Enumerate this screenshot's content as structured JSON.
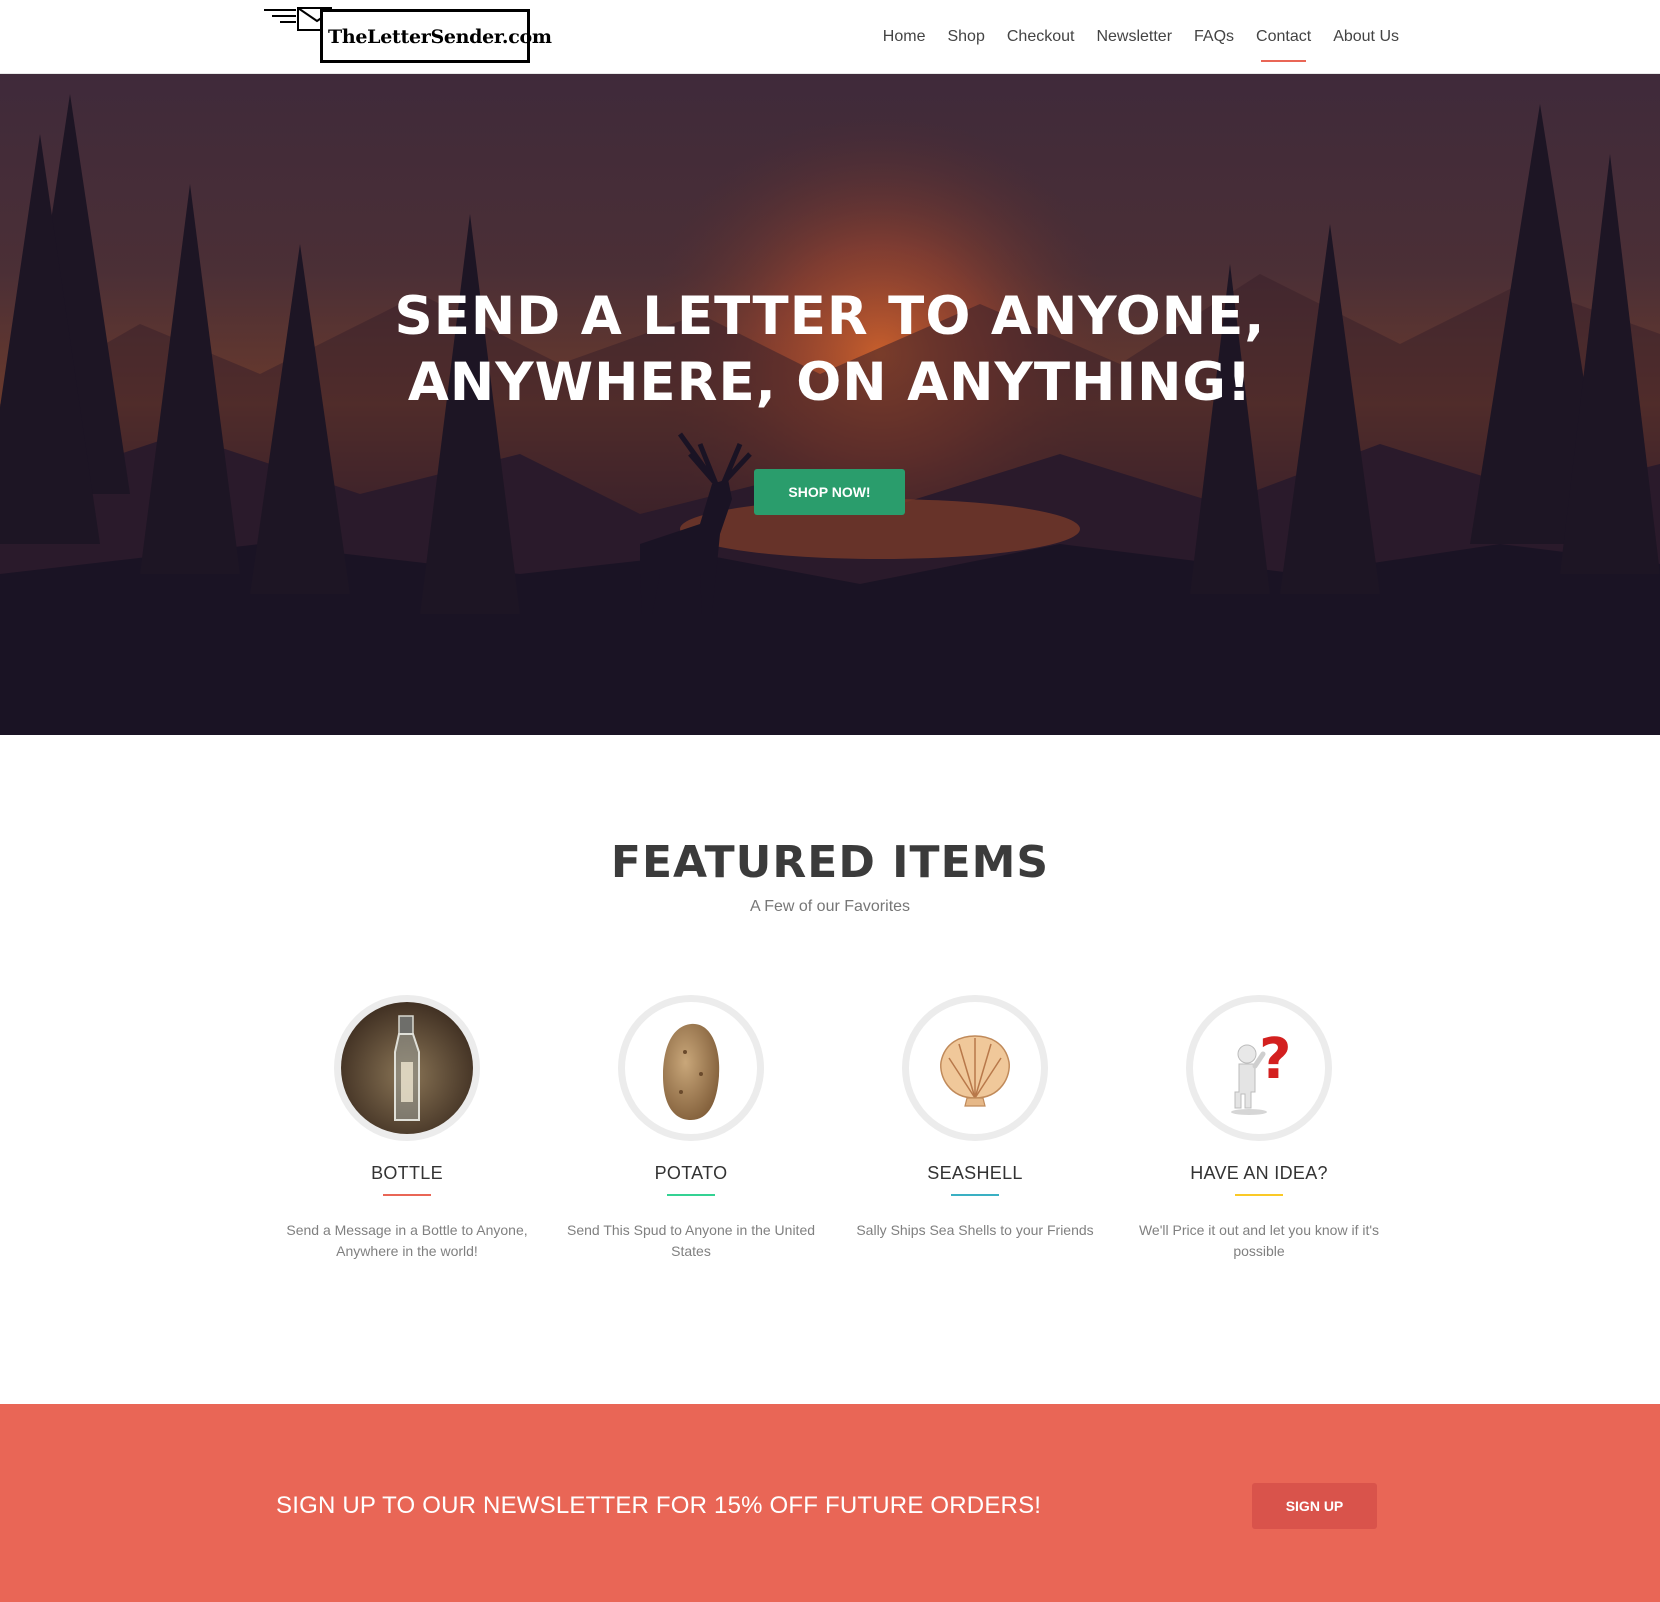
{
  "site": {
    "logo_text": "TheLetterSender.com"
  },
  "nav": {
    "items": [
      {
        "label": "Home"
      },
      {
        "label": "Shop"
      },
      {
        "label": "Checkout"
      },
      {
        "label": "Newsletter"
      },
      {
        "label": "FAQs"
      },
      {
        "label": "Contact",
        "active": true
      },
      {
        "label": "About Us"
      }
    ]
  },
  "hero": {
    "title_line1": "SEND A LETTER TO ANYONE,",
    "title_line2": "ANYWHERE, ON ANYTHING!",
    "button_label": "SHOP NOW!"
  },
  "featured": {
    "title": "FEATURED ITEMS",
    "subtitle": "A Few of our Favorites",
    "items": [
      {
        "name": "BOTTLE",
        "desc": "Send a Message in a Bottle to Anyone, Anywhere in the world!",
        "accent": "#e96656",
        "icon": "bottle-icon"
      },
      {
        "name": "POTATO",
        "desc": "Send This Spud to Anyone in the United States",
        "accent": "#34d293",
        "icon": "potato-icon"
      },
      {
        "name": "SEASHELL",
        "desc": "Sally Ships Sea Shells to your Friends",
        "accent": "#3ab0c3",
        "icon": "seashell-icon"
      },
      {
        "name": "HAVE AN IDEA?",
        "desc": "We'll Price it out and let you know if it's possible",
        "accent": "#fac926",
        "icon": "question-figure-icon"
      }
    ]
  },
  "newsletter_band": {
    "text": "SIGN UP TO OUR NEWSLETTER FOR 15% OFF FUTURE ORDERS!",
    "button_label": "SIGN UP"
  },
  "colors": {
    "accent_red": "#e96656",
    "hero_button": "#2a9d6c"
  }
}
